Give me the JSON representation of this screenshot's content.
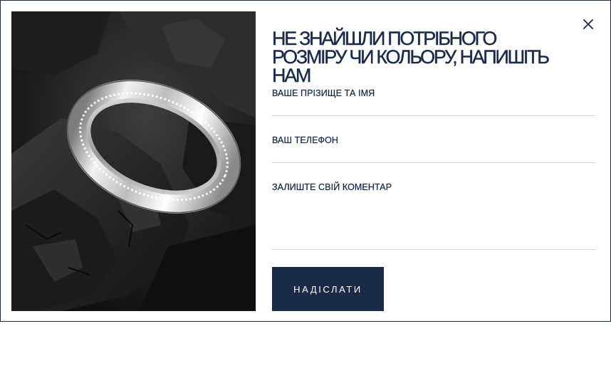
{
  "form": {
    "title": "НЕ ЗНАЙШЛИ ПОТРІБНОГО РОЗМІРУ ЧИ КОЛЬОРУ, НАПИШІТЬ НАМ",
    "name_label": "ВАШЕ ПРІЗИЩЕ ТА ІМЯ",
    "phone_label": "ВАШ ТЕЛЕФОН",
    "comment_label": "ЗАЛИШТЕ СВІЙ КОМЕНТАР",
    "submit_label": "НАДІСЛАТИ",
    "name_value": "",
    "phone_value": "",
    "comment_value": ""
  },
  "icons": {
    "close": "close-icon"
  },
  "colors": {
    "accent": "#1b2b47",
    "border": "#1c2c48",
    "divider": "#d6d8dc",
    "background": "#ffffff"
  }
}
